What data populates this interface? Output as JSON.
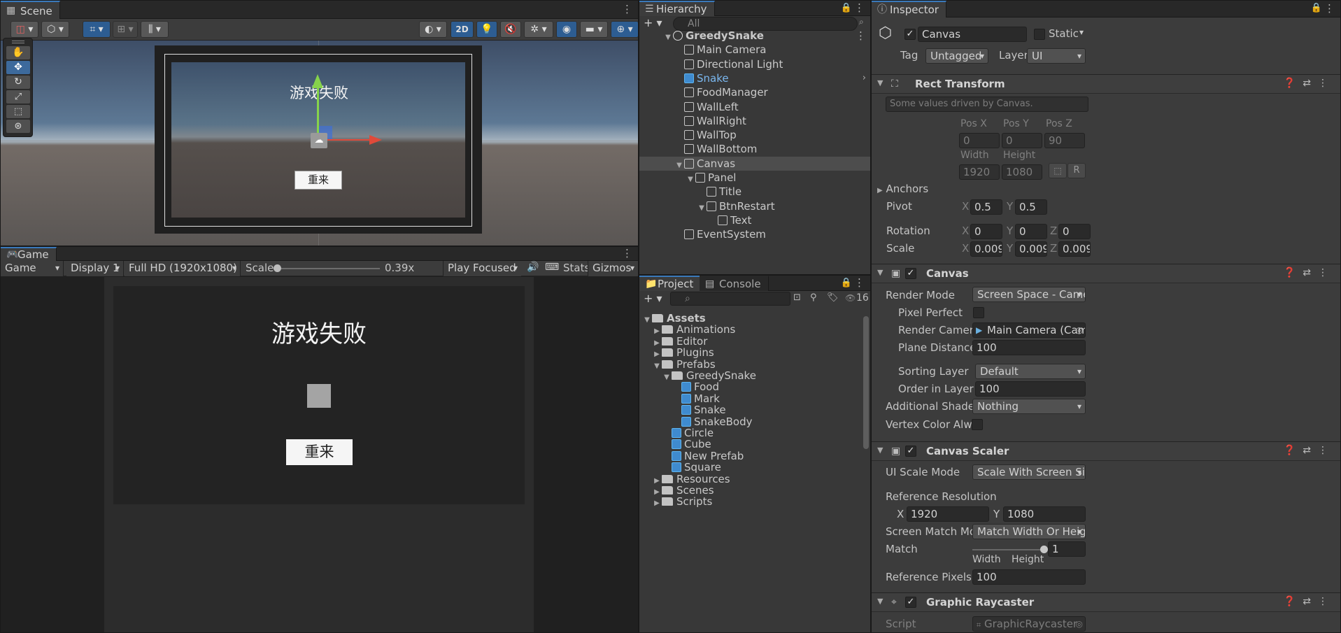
{
  "scene": {
    "tab": "Scene",
    "btn_2d": "2D",
    "tools": [
      "hand-tool",
      "move-tool",
      "rotate-tool",
      "scale-tool",
      "rect-tool",
      "transform-tool"
    ],
    "title": "游戏失败",
    "button": "重来"
  },
  "game": {
    "tab": "Game",
    "mode": "Game",
    "display": "Display 1",
    "resolution": "Full HD (1920x1080)",
    "scale_label": "Scale",
    "scale_value": "0.39x",
    "play_focused": "Play Focused",
    "stats": "Stats",
    "gizmos": "Gizmos",
    "title": "游戏失败",
    "button": "重来"
  },
  "hierarchy": {
    "tab": "Hierarchy",
    "search_placeholder": "All",
    "items": [
      {
        "label": "GreedySnake",
        "depth": 0,
        "arrow": "▼",
        "icon": "scene",
        "bold": true
      },
      {
        "label": "Main Camera",
        "depth": 1,
        "arrow": "",
        "icon": "cube"
      },
      {
        "label": "Directional Light",
        "depth": 1,
        "arrow": "",
        "icon": "cube"
      },
      {
        "label": "Snake",
        "depth": 1,
        "arrow": "",
        "icon": "prefab",
        "blue": true
      },
      {
        "label": "FoodManager",
        "depth": 1,
        "arrow": "",
        "icon": "cube"
      },
      {
        "label": "WallLeft",
        "depth": 1,
        "arrow": "",
        "icon": "cube"
      },
      {
        "label": "WallRight",
        "depth": 1,
        "arrow": "",
        "icon": "cube"
      },
      {
        "label": "WallTop",
        "depth": 1,
        "arrow": "",
        "icon": "cube"
      },
      {
        "label": "WallBottom",
        "depth": 1,
        "arrow": "",
        "icon": "cube"
      },
      {
        "label": "Canvas",
        "depth": 1,
        "arrow": "▼",
        "icon": "cube",
        "selected": true
      },
      {
        "label": "Panel",
        "depth": 2,
        "arrow": "▼",
        "icon": "cube"
      },
      {
        "label": "Title",
        "depth": 3,
        "arrow": "",
        "icon": "cube"
      },
      {
        "label": "BtnRestart",
        "depth": 3,
        "arrow": "▼",
        "icon": "cube"
      },
      {
        "label": "Text",
        "depth": 4,
        "arrow": "",
        "icon": "cube"
      },
      {
        "label": "EventSystem",
        "depth": 1,
        "arrow": "",
        "icon": "cube"
      }
    ]
  },
  "project": {
    "tab_project": "Project",
    "tab_console": "Console",
    "count": "16",
    "items": [
      {
        "label": "Assets",
        "depth": 0,
        "arrow": "▼",
        "icon": "folder-open"
      },
      {
        "label": "Animations",
        "depth": 1,
        "arrow": "▶",
        "icon": "folder"
      },
      {
        "label": "Editor",
        "depth": 1,
        "arrow": "▶",
        "icon": "folder"
      },
      {
        "label": "Plugins",
        "depth": 1,
        "arrow": "▶",
        "icon": "folder"
      },
      {
        "label": "Prefabs",
        "depth": 1,
        "arrow": "▼",
        "icon": "folder-open"
      },
      {
        "label": "GreedySnake",
        "depth": 2,
        "arrow": "▼",
        "icon": "folder-open"
      },
      {
        "label": "Food",
        "depth": 3,
        "arrow": "",
        "icon": "prefab"
      },
      {
        "label": "Mark",
        "depth": 3,
        "arrow": "",
        "icon": "prefab"
      },
      {
        "label": "Snake",
        "depth": 3,
        "arrow": "",
        "icon": "prefab"
      },
      {
        "label": "SnakeBody",
        "depth": 3,
        "arrow": "",
        "icon": "prefab"
      },
      {
        "label": "Circle",
        "depth": 2,
        "arrow": "",
        "icon": "prefab"
      },
      {
        "label": "Cube",
        "depth": 2,
        "arrow": "",
        "icon": "prefab"
      },
      {
        "label": "New Prefab",
        "depth": 2,
        "arrow": "",
        "icon": "prefab"
      },
      {
        "label": "Square",
        "depth": 2,
        "arrow": "",
        "icon": "prefab"
      },
      {
        "label": "Resources",
        "depth": 1,
        "arrow": "▶",
        "icon": "folder"
      },
      {
        "label": "Scenes",
        "depth": 1,
        "arrow": "▶",
        "icon": "folder"
      },
      {
        "label": "Scripts",
        "depth": 1,
        "arrow": "▶",
        "icon": "folder"
      }
    ]
  },
  "inspector": {
    "tab": "Inspector",
    "object_name": "Canvas",
    "static_label": "Static",
    "tag_label": "Tag",
    "tag_value": "Untagged",
    "layer_label": "Layer",
    "layer_value": "UI",
    "rect": {
      "title": "Rect Transform",
      "note": "Some values driven by Canvas.",
      "posx_label": "Pos X",
      "posy_label": "Pos Y",
      "posz_label": "Pos Z",
      "posx": "0",
      "posy": "0",
      "posz": "90",
      "width_label": "Width",
      "height_label": "Height",
      "width": "1920",
      "height": "1080",
      "r_btn": "R",
      "anchors": "Anchors",
      "pivot": "Pivot",
      "pivot_x": "0.5",
      "pivot_y": "0.5",
      "rotation": "Rotation",
      "rot_x": "0",
      "rot_y": "0",
      "rot_z": "0",
      "scale": "Scale",
      "scale_x": "0.009",
      "scale_y": "0.009",
      "scale_z": "0.009",
      "x": "X",
      "y": "Y",
      "z": "Z"
    },
    "canvas": {
      "title": "Canvas",
      "render_mode_label": "Render Mode",
      "render_mode": "Screen Space - Camera",
      "pixel_perfect": "Pixel Perfect",
      "render_camera_label": "Render Camera",
      "render_camera": "Main Camera (Came",
      "plane_distance_label": "Plane Distance",
      "plane_distance": "100",
      "sorting_layer_label": "Sorting Layer",
      "sorting_layer": "Default",
      "order_label": "Order in Layer",
      "order": "100",
      "shader_label": "Additional Shader Ch",
      "shader": "Nothing",
      "vertex_label": "Vertex Color Always"
    },
    "scaler": {
      "title": "Canvas Scaler",
      "mode_label": "UI Scale Mode",
      "mode": "Scale With Screen Size",
      "ref_label": "Reference Resolution",
      "x": "X",
      "ref_x": "1920",
      "y": "Y",
      "ref_y": "1080",
      "match_mode_label": "Screen Match Mode",
      "match_mode": "Match Width Or Height",
      "match_label": "Match",
      "match_value": "1",
      "match_fraction": 1.0,
      "width": "Width",
      "height": "Height",
      "ppu_label": "Reference Pixels Per",
      "ppu": "100"
    },
    "raycaster": {
      "title": "Graphic Raycaster",
      "script_label": "Script",
      "script": "GraphicRaycaster"
    }
  }
}
